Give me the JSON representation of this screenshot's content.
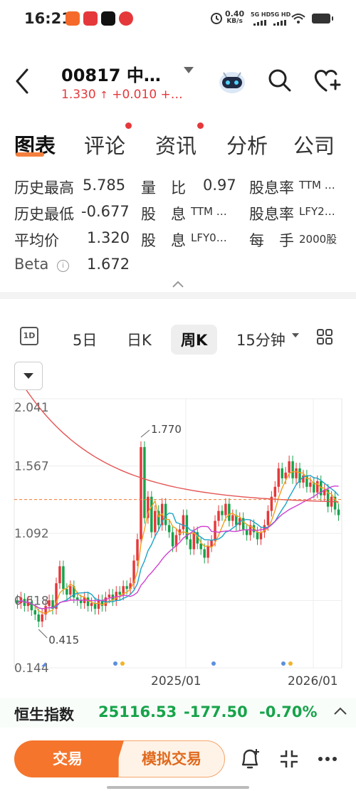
{
  "status_bar": {
    "time": "16:21",
    "net_speed": "0.40",
    "net_unit": "KB/s",
    "sim1": "5G HD",
    "sim2": "5G HD"
  },
  "header": {
    "title": "00817 中…",
    "price": "1.330",
    "change": "+0.010",
    "change_pct": "+…"
  },
  "tabs": [
    {
      "label": "图表",
      "active": true
    },
    {
      "label": "评论",
      "dot": true
    },
    {
      "label": "资讯",
      "dot": true
    },
    {
      "label": "分析"
    },
    {
      "label": "公司"
    }
  ],
  "stats": {
    "hist_high_label": "历史最高",
    "hist_high_value": "5.785",
    "hist_low_label": "历史最低",
    "hist_low_value": "-0.677",
    "avg_label": "平均价",
    "avg_value": "1.320",
    "beta_label": "Beta",
    "beta_value": "1.672",
    "vol_ratio_label": "量　比",
    "vol_ratio_value": "0.97",
    "div_ttm_label": "股　息",
    "div_ttm_value": "TTM …",
    "div_lfy_label": "股　息",
    "div_lfy_value": "LFY0…",
    "yield_ttm_label": "股息率",
    "yield_ttm_value": "TTM …",
    "yield_lfy_label": "股息率",
    "yield_lfy_value": "LFY2…",
    "lot_label": "每　手",
    "lot_value": "2000股"
  },
  "periods": [
    {
      "label": "5日"
    },
    {
      "label": "日K"
    },
    {
      "label": "周K",
      "active": true
    },
    {
      "label": "15分钟"
    }
  ],
  "chart_data": {
    "type": "candlestick",
    "y_ticks": [
      "2.041",
      "1.567",
      "1.092",
      "0.618",
      "0.144"
    ],
    "ylim": [
      0.144,
      2.041
    ],
    "x_labels": [
      "2025/01",
      "2026/01"
    ],
    "annotations": [
      {
        "text": "1.770",
        "value": 1.77
      },
      {
        "text": "0.415",
        "value": 0.415
      }
    ],
    "reference_price": 1.33,
    "candles": [
      [
        0.62,
        0.6
      ],
      [
        0.6,
        0.64
      ],
      [
        0.63,
        0.58
      ],
      [
        0.58,
        0.61
      ],
      [
        0.61,
        0.55
      ],
      [
        0.55,
        0.52
      ],
      [
        0.52,
        0.47
      ],
      [
        0.47,
        0.52
      ],
      [
        0.52,
        0.58
      ],
      [
        0.58,
        0.62
      ],
      [
        0.62,
        0.56
      ],
      [
        0.56,
        0.74
      ],
      [
        0.74,
        0.86
      ],
      [
        0.86,
        0.7
      ],
      [
        0.7,
        0.66
      ],
      [
        0.66,
        0.72
      ],
      [
        0.72,
        0.64
      ],
      [
        0.64,
        0.62
      ],
      [
        0.62,
        0.6
      ],
      [
        0.6,
        0.64
      ],
      [
        0.64,
        0.58
      ],
      [
        0.58,
        0.6
      ],
      [
        0.6,
        0.56
      ],
      [
        0.56,
        0.62
      ],
      [
        0.62,
        0.58
      ],
      [
        0.58,
        0.64
      ],
      [
        0.64,
        0.66
      ],
      [
        0.66,
        0.62
      ],
      [
        0.62,
        0.68
      ],
      [
        0.68,
        0.66
      ],
      [
        0.66,
        0.72
      ],
      [
        0.72,
        0.7
      ],
      [
        0.7,
        0.74
      ],
      [
        0.74,
        0.9
      ],
      [
        0.9,
        1.05
      ],
      [
        1.05,
        1.7
      ],
      [
        1.7,
        1.2
      ],
      [
        1.2,
        1.35
      ],
      [
        1.35,
        1.1
      ],
      [
        1.1,
        1.25
      ],
      [
        1.25,
        1.15
      ],
      [
        1.15,
        1.3
      ],
      [
        1.3,
        1.15
      ],
      [
        1.15,
        1.1
      ],
      [
        1.1,
        1.0
      ],
      [
        1.0,
        1.08
      ],
      [
        1.08,
        1.12
      ],
      [
        1.12,
        1.22
      ],
      [
        1.22,
        1.05
      ],
      [
        1.05,
        0.98
      ],
      [
        0.98,
        1.1
      ],
      [
        1.1,
        1.02
      ],
      [
        1.02,
        0.98
      ],
      [
        0.98,
        0.92
      ],
      [
        0.92,
        1.0
      ],
      [
        1.0,
        1.04
      ],
      [
        1.04,
        1.18
      ],
      [
        1.18,
        1.25
      ],
      [
        1.25,
        1.22
      ],
      [
        1.22,
        1.3
      ],
      [
        1.3,
        1.18
      ],
      [
        1.18,
        1.22
      ],
      [
        1.22,
        1.15
      ],
      [
        1.15,
        1.2
      ],
      [
        1.2,
        1.12
      ],
      [
        1.12,
        1.08
      ],
      [
        1.08,
        1.15
      ],
      [
        1.15,
        1.1
      ],
      [
        1.1,
        1.05
      ],
      [
        1.05,
        1.1
      ],
      [
        1.1,
        1.15
      ],
      [
        1.15,
        1.25
      ],
      [
        1.25,
        1.35
      ],
      [
        1.35,
        1.42
      ],
      [
        1.42,
        1.55
      ],
      [
        1.55,
        1.48
      ],
      [
        1.48,
        1.52
      ],
      [
        1.52,
        1.6
      ],
      [
        1.6,
        1.48
      ],
      [
        1.48,
        1.55
      ],
      [
        1.55,
        1.45
      ],
      [
        1.45,
        1.5
      ],
      [
        1.5,
        1.42
      ],
      [
        1.42,
        1.45
      ],
      [
        1.45,
        1.38
      ],
      [
        1.38,
        1.46
      ],
      [
        1.46,
        1.36
      ],
      [
        1.36,
        1.4
      ],
      [
        1.4,
        1.28
      ],
      [
        1.28,
        1.35
      ],
      [
        1.35,
        1.26
      ],
      [
        1.26,
        1.22
      ]
    ]
  },
  "index_bar": {
    "name": "恒生指数",
    "value": "25116.53",
    "change": "-177.50",
    "change_pct": "-0.70%"
  },
  "bottom": {
    "trade_label": "交易",
    "sim_label": "模拟交易"
  },
  "colors": {
    "up": "#e5383b",
    "down": "#17a34a",
    "accent": "#f5752d"
  }
}
